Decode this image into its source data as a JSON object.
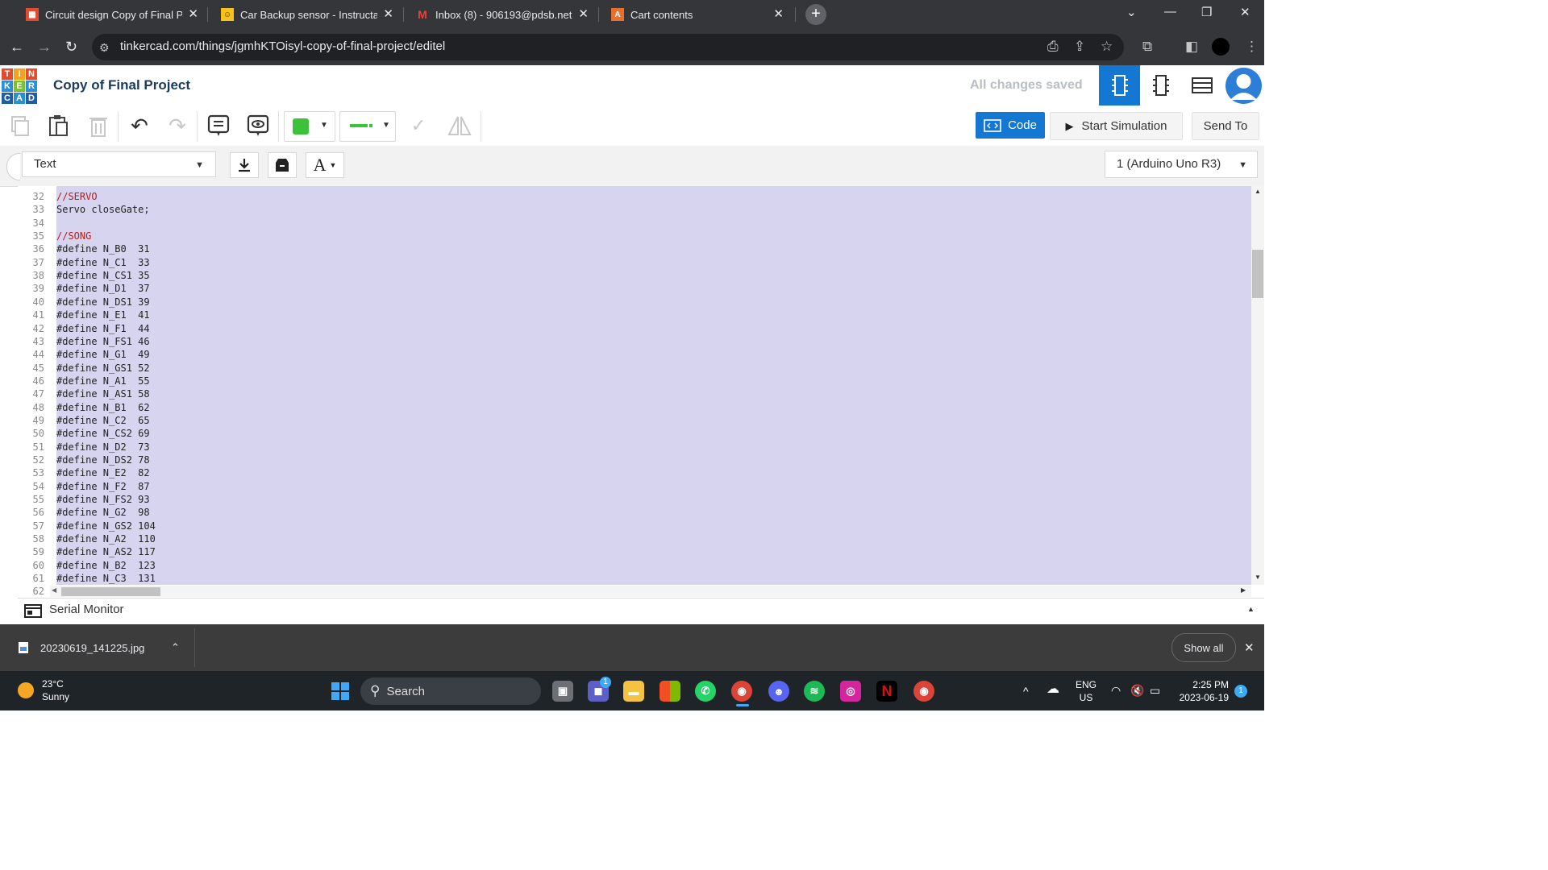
{
  "browser": {
    "tabs": [
      {
        "title": "Circuit design Copy of Final Pro",
        "fav": "TK",
        "fav_bg": "#e24b2c",
        "active": true
      },
      {
        "title": "Car Backup sensor - Instructabl",
        "fav": "🤖",
        "fav_bg": "#f9c11a",
        "active": false
      },
      {
        "title": "Inbox (8) - 906193@pdsb.net -",
        "fav": "M",
        "fav_bg": "#ffffff",
        "active": false
      },
      {
        "title": "Cart contents",
        "fav": "A",
        "fav_bg": "#e8702a",
        "active": false
      }
    ],
    "url": "tinkercad.com/things/jgmhKTOisyl-copy-of-final-project/editel"
  },
  "app": {
    "logo_letters": [
      "T",
      "I",
      "N",
      "K",
      "E",
      "R",
      "C",
      "A",
      "D"
    ],
    "project_title": "Copy of Final Project",
    "save_status": "All changes saved"
  },
  "toolbar": {
    "code_label": "Code",
    "simulate_label": "Start Simulation",
    "send_label": "Send To",
    "fill_color": "#3cc13b"
  },
  "editor_bar": {
    "mode": "Text",
    "device": "1 (Arduino Uno R3)"
  },
  "code": {
    "lines": [
      {
        "n": "32",
        "text": "//SERVO",
        "comment": true
      },
      {
        "n": "33",
        "text": "Servo closeGate;",
        "comment": false
      },
      {
        "n": "34",
        "text": "",
        "comment": false
      },
      {
        "n": "35",
        "text": "//SONG",
        "comment": true
      },
      {
        "n": "36",
        "text": "#define N_B0  31",
        "comment": false
      },
      {
        "n": "37",
        "text": "#define N_C1  33",
        "comment": false
      },
      {
        "n": "38",
        "text": "#define N_CS1 35",
        "comment": false
      },
      {
        "n": "39",
        "text": "#define N_D1  37",
        "comment": false
      },
      {
        "n": "40",
        "text": "#define N_DS1 39",
        "comment": false
      },
      {
        "n": "41",
        "text": "#define N_E1  41",
        "comment": false
      },
      {
        "n": "42",
        "text": "#define N_F1  44",
        "comment": false
      },
      {
        "n": "43",
        "text": "#define N_FS1 46",
        "comment": false
      },
      {
        "n": "44",
        "text": "#define N_G1  49",
        "comment": false
      },
      {
        "n": "45",
        "text": "#define N_GS1 52",
        "comment": false
      },
      {
        "n": "46",
        "text": "#define N_A1  55",
        "comment": false
      },
      {
        "n": "47",
        "text": "#define N_AS1 58",
        "comment": false
      },
      {
        "n": "48",
        "text": "#define N_B1  62",
        "comment": false
      },
      {
        "n": "49",
        "text": "#define N_C2  65",
        "comment": false
      },
      {
        "n": "50",
        "text": "#define N_CS2 69",
        "comment": false
      },
      {
        "n": "51",
        "text": "#define N_D2  73",
        "comment": false
      },
      {
        "n": "52",
        "text": "#define N_DS2 78",
        "comment": false
      },
      {
        "n": "53",
        "text": "#define N_E2  82",
        "comment": false
      },
      {
        "n": "54",
        "text": "#define N_F2  87",
        "comment": false
      },
      {
        "n": "55",
        "text": "#define N_FS2 93",
        "comment": false
      },
      {
        "n": "56",
        "text": "#define N_G2  98",
        "comment": false
      },
      {
        "n": "57",
        "text": "#define N_GS2 104",
        "comment": false
      },
      {
        "n": "58",
        "text": "#define N_A2  110",
        "comment": false
      },
      {
        "n": "59",
        "text": "#define N_AS2 117",
        "comment": false
      },
      {
        "n": "60",
        "text": "#define N_B2  123",
        "comment": false
      },
      {
        "n": "61",
        "text": "#define N_C3  131",
        "comment": false
      }
    ],
    "last_visible_line": "62"
  },
  "serial_monitor": {
    "label": "Serial Monitor"
  },
  "downloads": {
    "file": "20230619_141225.jpg",
    "show_all": "Show all"
  },
  "taskbar": {
    "temp": "23°C",
    "condition": "Sunny",
    "search_placeholder": "Search",
    "lang": "ENG",
    "region": "US",
    "time": "2:25 PM",
    "date": "2023-06-19",
    "notif_count": "1",
    "teams_badge": "1"
  }
}
